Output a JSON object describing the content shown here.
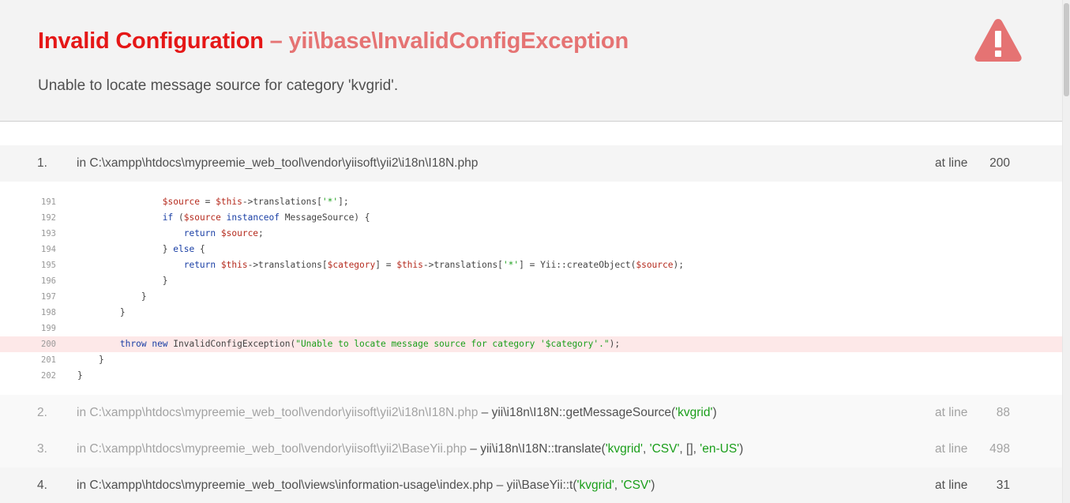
{
  "header": {
    "title_prefix": "Invalid Configuration",
    "title_sep": " – ",
    "exception": "yii\\base\\InvalidConfigException",
    "message": "Unable to locate message source for category 'kvgrid'."
  },
  "icons": {
    "warning": "warning-triangle-icon"
  },
  "colors": {
    "title": "#e51717",
    "exception": "#e57373",
    "string": "#1a9e1a",
    "error_line": "#fde8e8"
  },
  "trace": [
    {
      "num": "1.",
      "file": "in C:\\xampp\\htdocs\\mypreemie_web_tool\\vendor\\yiisoft\\yii2\\i18n\\I18N.php",
      "at": "at line",
      "line": "200"
    },
    {
      "num": "2.",
      "file": "in C:\\xampp\\htdocs\\mypreemie_web_tool\\vendor\\yiisoft\\yii2\\i18n\\I18N.php",
      "sep": " – ",
      "fn": "yii\\i18n\\I18N::getMessageSource(",
      "args": [
        "'kvgrid'"
      ],
      "close": ")",
      "at": "at line",
      "line": "88"
    },
    {
      "num": "3.",
      "file": "in C:\\xampp\\htdocs\\mypreemie_web_tool\\vendor\\yiisoft\\yii2\\BaseYii.php",
      "sep": " – ",
      "fn": "yii\\i18n\\I18N::translate(",
      "args": [
        "'kvgrid'",
        "'CSV'",
        "[]",
        "'en-US'"
      ],
      "close": ")",
      "at": "at line",
      "line": "498"
    },
    {
      "num": "4.",
      "file": "in C:\\xampp\\htdocs\\mypreemie_web_tool\\views\\information-usage\\index.php",
      "sep": " – ",
      "fn": "yii\\BaseYii::t(",
      "args": [
        "'kvgrid'",
        "'CSV'"
      ],
      "close": ")",
      "at": "at line",
      "line": "31"
    }
  ],
  "code": {
    "lines": [
      {
        "n": "191",
        "text": "                $source = $this->translations['*'];"
      },
      {
        "n": "192",
        "text": "                if ($source instanceof MessageSource) {"
      },
      {
        "n": "193",
        "text": "                    return $source;"
      },
      {
        "n": "194",
        "text": "                } else {"
      },
      {
        "n": "195",
        "text": "                    return $this->translations[$category] = $this->translations['*'] = Yii::createObject($source);"
      },
      {
        "n": "196",
        "text": "                }"
      },
      {
        "n": "197",
        "text": "            }"
      },
      {
        "n": "198",
        "text": "        }"
      },
      {
        "n": "199",
        "text": ""
      },
      {
        "n": "200",
        "text": "        throw new InvalidConfigException(\"Unable to locate message source for category '$category'.\");"
      },
      {
        "n": "201",
        "text": "    }"
      },
      {
        "n": "202",
        "text": "}"
      }
    ],
    "error_line": "200"
  }
}
